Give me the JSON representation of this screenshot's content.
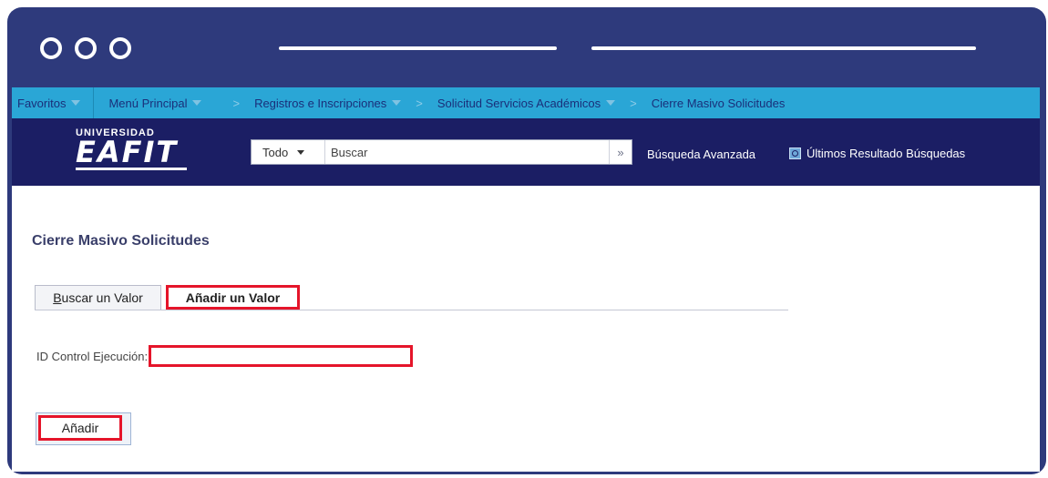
{
  "nav": {
    "favorites": "Favoritos",
    "main_menu": "Menú Principal",
    "breadcrumb": [
      "Registros e Inscripciones",
      "Solicitud Servicios Académicos",
      "Cierre Masivo Solicitudes"
    ],
    "separator": ">"
  },
  "header": {
    "logo_top": "UNIVERSIDAD",
    "logo_main": "EAFIT",
    "search_scope": "Todo",
    "search_placeholder": "Buscar",
    "search_go": "»",
    "advanced_search": "Búsqueda Avanzada",
    "recent_searches": "Últimos Resultado Búsquedas"
  },
  "page": {
    "title": "Cierre Masivo Solicitudes",
    "tab_search_first": "B",
    "tab_search_rest": "uscar un Valor",
    "tab_add": "Añadir un Valor",
    "field_label": "ID Control Ejecución:",
    "field_value": "",
    "add_button": "Añadir"
  },
  "colors": {
    "frame": "#2e3a7c",
    "navbar": "#2aa6d6",
    "header": "#1b1e64",
    "highlight": "#e5152a"
  }
}
